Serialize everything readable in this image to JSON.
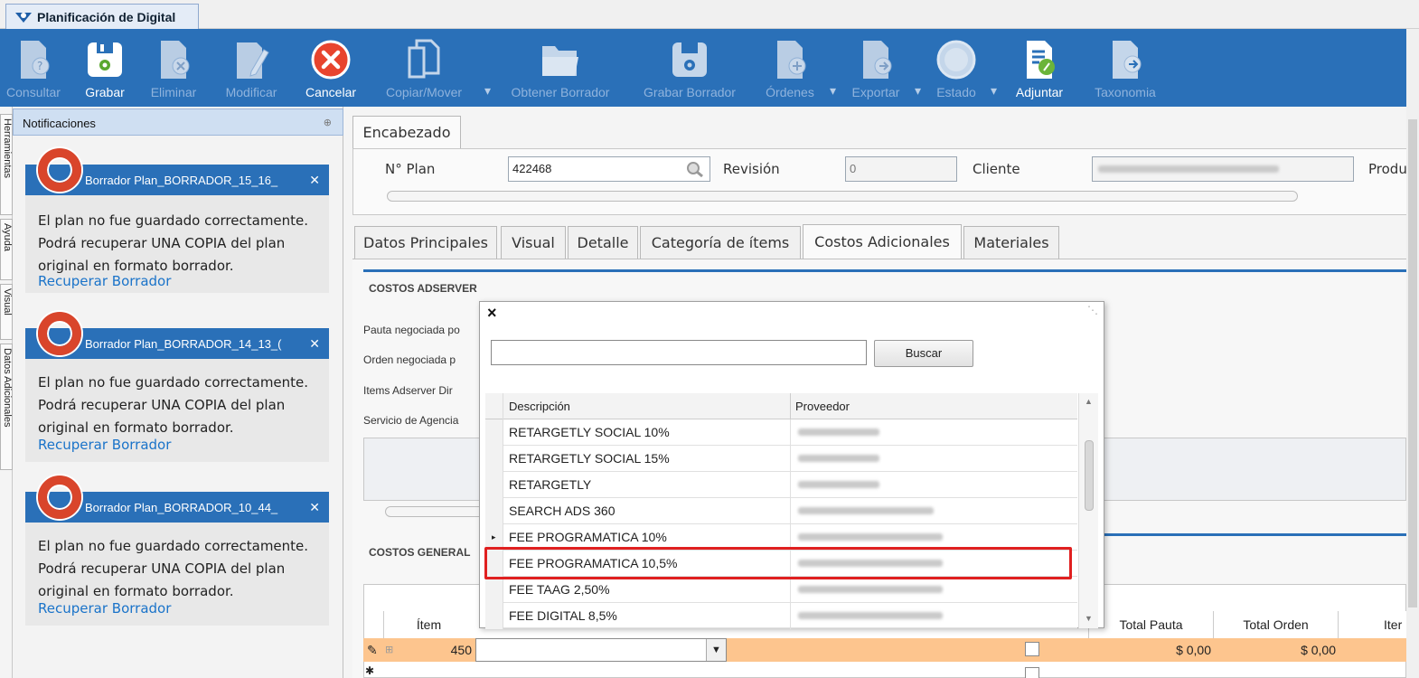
{
  "window": {
    "title": "Planificación de Digital"
  },
  "toolbar": {
    "buttons": [
      {
        "label": "Consultar",
        "icon": "doc-question-icon",
        "enabled": false
      },
      {
        "label": "Grabar",
        "icon": "save-icon",
        "enabled": true
      },
      {
        "label": "Eliminar",
        "icon": "doc-delete-icon",
        "enabled": false
      },
      {
        "label": "Modificar",
        "icon": "doc-edit-icon",
        "enabled": false
      },
      {
        "label": "Cancelar",
        "icon": "cancel-icon",
        "enabled": true
      },
      {
        "label": "Copiar/Mover",
        "icon": "copy-icon",
        "enabled": false
      },
      {
        "label": "Obtener Borrador",
        "icon": "folder-open-icon",
        "enabled": false
      },
      {
        "label": "Grabar Borrador",
        "icon": "save-draft-icon",
        "enabled": false
      },
      {
        "label": "Órdenes",
        "icon": "doc-add-icon",
        "enabled": false
      },
      {
        "label": "Exportar",
        "icon": "doc-export-icon",
        "enabled": false
      },
      {
        "label": "Estado",
        "icon": "status-icon",
        "enabled": false
      },
      {
        "label": "Adjuntar",
        "icon": "attach-icon",
        "enabled": true
      },
      {
        "label": "Taxonomia",
        "icon": "doc-arrow-icon",
        "enabled": false
      }
    ]
  },
  "side_tabs": [
    "Herramientas",
    "Ayuda",
    "Visual",
    "Datos Adicionales"
  ],
  "notifications": {
    "title": "Notificaciones",
    "items": [
      {
        "title": "Borrador Plan_BORRADOR_15_16_",
        "message": [
          "El plan no fue guardado correctamente.",
          "Podrá recuperar UNA COPIA del plan",
          "original en formato borrador."
        ],
        "link": "Recuperar Borrador"
      },
      {
        "title": "Borrador Plan_BORRADOR_14_13_(",
        "message": [
          "El plan no fue guardado correctamente.",
          "Podrá recuperar UNA COPIA del plan",
          "original en formato borrador."
        ],
        "link": "Recuperar Borrador"
      },
      {
        "title": "Borrador Plan_BORRADOR_10_44_",
        "message": [
          "El plan no fue guardado correctamente.",
          "Podrá recuperar UNA COPIA del plan",
          "original en formato borrador."
        ],
        "link": "Recuperar Borrador"
      }
    ]
  },
  "header": {
    "tab": "Encabezado",
    "plan_label": "N° Plan",
    "plan_value": "422468",
    "revision_label": "Revisión",
    "revision_value": "0",
    "cliente_label": "Cliente",
    "producto_label_partial": "Produ"
  },
  "tabs": [
    "Datos Principales",
    "Visual",
    "Detalle",
    "Categoría de ítems",
    "Costos Adicionales",
    "Materiales"
  ],
  "active_tab": "Costos Adicionales",
  "adserver": {
    "section_title": "COSTOS ADSERVER",
    "rows": [
      "Pauta negociada po",
      "Orden negociada p",
      "Items Adserver Dir",
      "Servicio de Agencia"
    ]
  },
  "generales": {
    "section_title": "COSTOS GENERAL"
  },
  "popup": {
    "search_value": "",
    "search_button": "Buscar",
    "columns": [
      "Descripción",
      "Proveedor"
    ],
    "rows": [
      "RETARGETLY SOCIAL 10%",
      "RETARGETLY SOCIAL 15%",
      "RETARGETLY",
      "SEARCH ADS 360",
      "FEE PROGRAMATICA 10%",
      "FEE PROGRAMATICA 10,5%",
      "FEE TAAG 2,50%",
      "FEE DIGITAL 8,5%"
    ],
    "current_row_marker": "▸"
  },
  "bottom_grid": {
    "columns": [
      "Ítem",
      "Total Pauta",
      "Total Orden",
      "Iter"
    ],
    "edit_row": {
      "item": "450",
      "total_pauta": "$ 0,00",
      "total_orden": "$ 0,00"
    }
  },
  "colors": {
    "accent": "#2a70b8",
    "highlight": "#e02020",
    "edit_row": "#fdc58e",
    "link": "#1a73c9"
  }
}
